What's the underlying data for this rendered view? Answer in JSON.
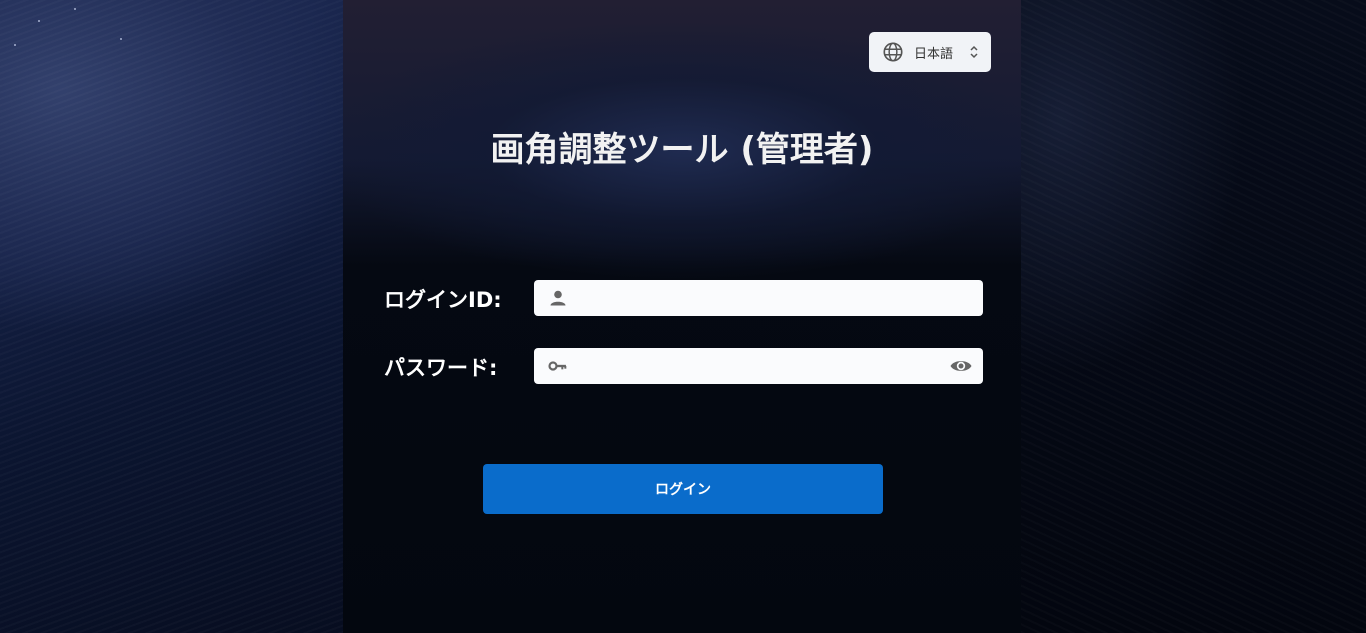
{
  "language_selector": {
    "current": "日本語",
    "globe_icon": "globe-icon",
    "chevron_icon": "chevron-up-down-icon"
  },
  "header": {
    "title": "画角調整ツール (管理者)"
  },
  "form": {
    "login_id": {
      "label": "ログインID:",
      "value": "",
      "placeholder": "",
      "icon": "user-icon"
    },
    "password": {
      "label": "パスワード:",
      "value": "",
      "placeholder": "",
      "icon": "key-icon",
      "toggle_icon": "eye-icon"
    },
    "submit_label": "ログイン"
  },
  "colors": {
    "button": "#0a6ccb",
    "background": "#050a18",
    "text": "#ffffff"
  }
}
